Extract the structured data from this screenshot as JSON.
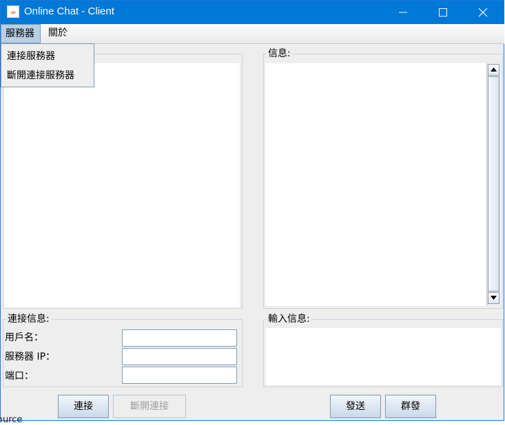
{
  "window": {
    "title": "Online Chat - Client",
    "app_icon": "java-coffee-icon",
    "icon_glyph": "☕",
    "controls": [
      "minimize-icon",
      "maximize-icon",
      "close-icon"
    ],
    "accent_color": "#0078d7"
  },
  "menubar": {
    "items": [
      {
        "label": "服務器"
      },
      {
        "label": "關於"
      }
    ],
    "open_menu": {
      "items": [
        {
          "label": "連接服務器"
        },
        {
          "label": "斷開連接服務器"
        }
      ]
    }
  },
  "message_panel": {
    "legend": "信息:"
  },
  "connection_panel": {
    "legend": "連接信息:",
    "fields": [
      {
        "label": "用戶名：",
        "value": ""
      },
      {
        "label": "服務器 IP：",
        "value": ""
      },
      {
        "label": "端口：",
        "value": ""
      }
    ]
  },
  "input_panel": {
    "legend": "輸入信息:"
  },
  "buttons": {
    "connect": "連接",
    "disconnect": "斷開連接",
    "send": "發送",
    "group_send": "群發"
  },
  "background_text": "ource"
}
